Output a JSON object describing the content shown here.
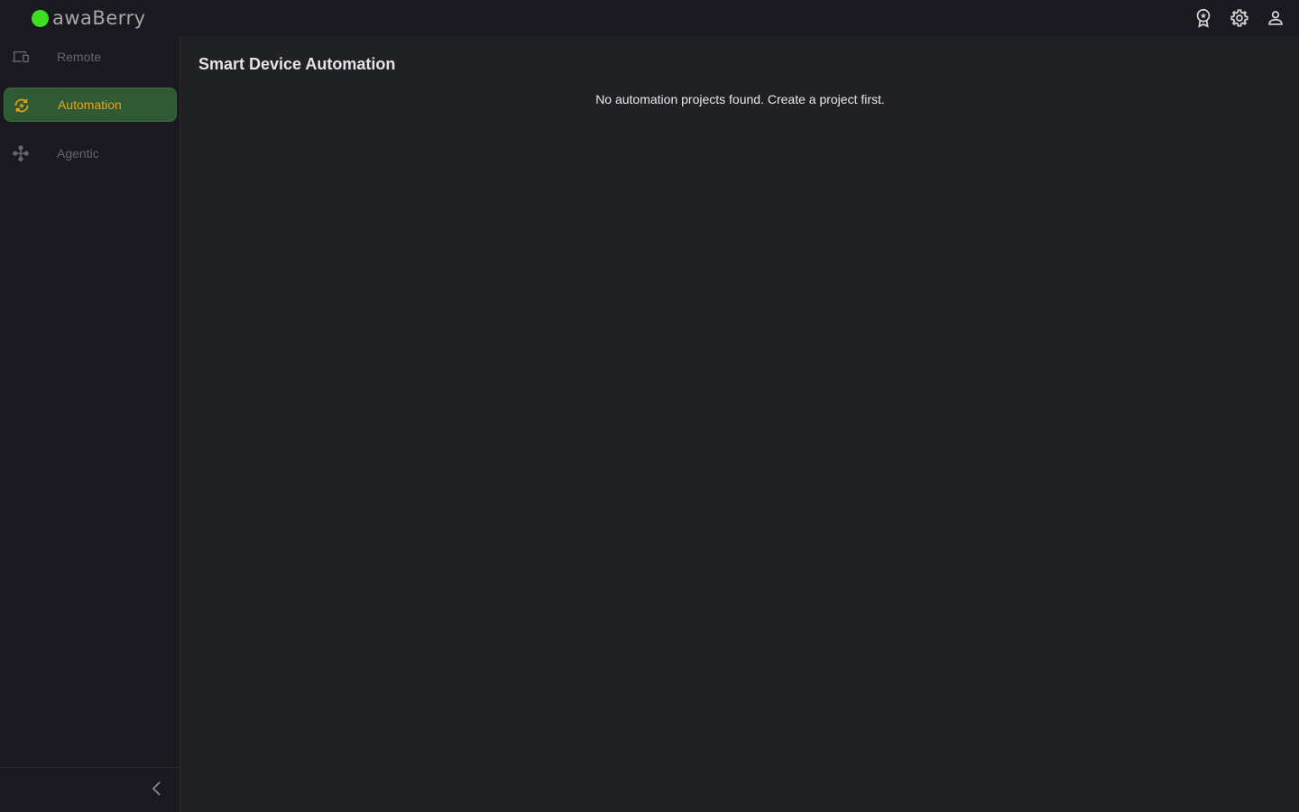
{
  "brand": {
    "name": "awaBerry",
    "dot_color": "#3fdd1f"
  },
  "header": {
    "actions": [
      {
        "icon": "award-icon",
        "label": "Awards"
      },
      {
        "icon": "gear-icon",
        "label": "Settings"
      },
      {
        "icon": "user-icon",
        "label": "Account"
      }
    ]
  },
  "sidebar": {
    "items": [
      {
        "label": "Remote",
        "icon": "devices-icon",
        "active": false
      },
      {
        "label": "Automation",
        "icon": "automation-icon",
        "active": true
      },
      {
        "label": "Agentic",
        "icon": "agentic-icon",
        "active": false
      }
    ],
    "collapse_icon": "chevron-left-icon"
  },
  "main": {
    "title": "Smart Device Automation",
    "empty_message": "No automation projects found. Create a project first."
  },
  "colors": {
    "accent_active_bg": "#2f5a33",
    "accent_active_text": "#e8a319",
    "inactive_text": "#66656c"
  }
}
